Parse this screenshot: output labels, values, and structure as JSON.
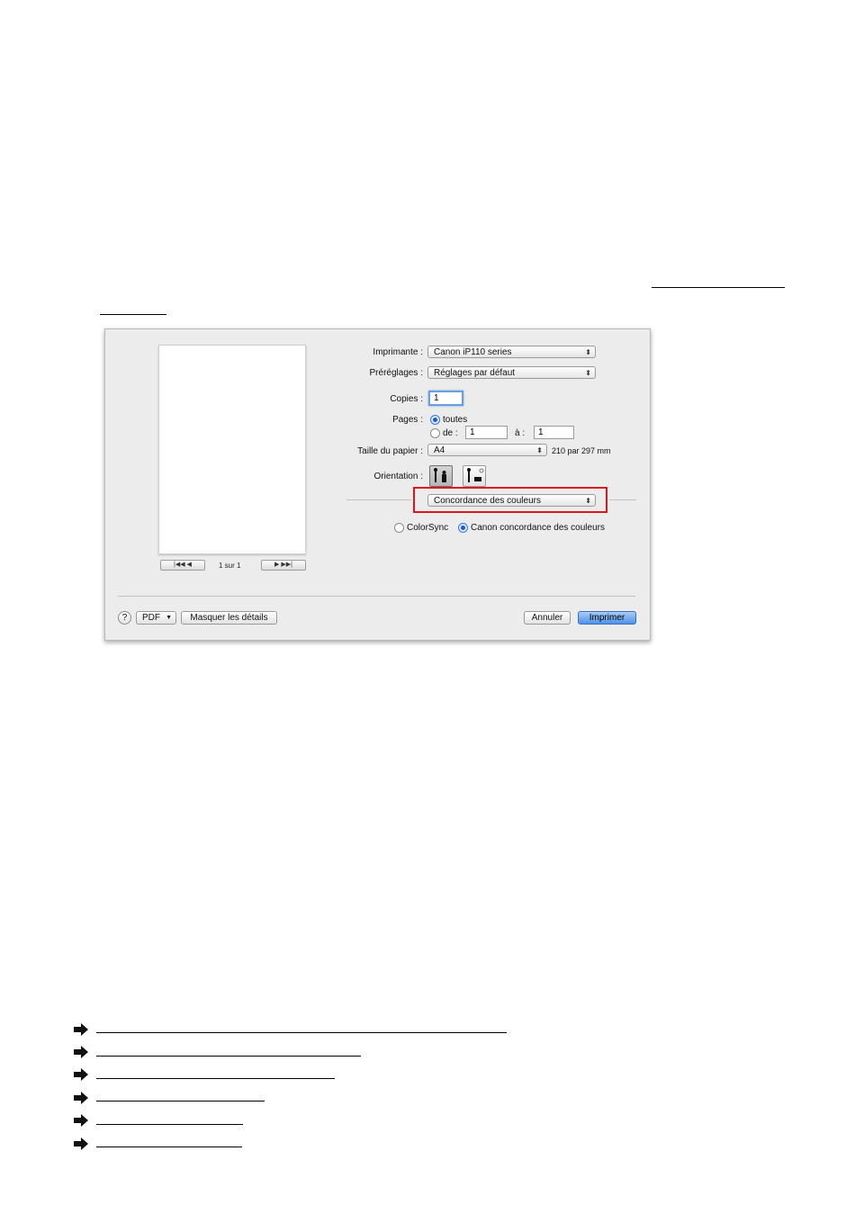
{
  "dialog": {
    "pager": {
      "first_prev": "|◀◀  ◀",
      "next_last": "▶  ▶▶|",
      "label": "1 sur 1"
    },
    "printer": {
      "label": "Imprimante :",
      "value": "Canon iP110 series"
    },
    "presets": {
      "label": "Préréglages :",
      "value": "Réglages par défaut"
    },
    "copies": {
      "label": "Copies :",
      "value": "1"
    },
    "pages": {
      "label": "Pages :",
      "all_label": "toutes",
      "from_label": "de :",
      "from_value": "1",
      "to_label": "à :",
      "to_value": "1",
      "selected": "all"
    },
    "paper_size": {
      "label": "Taille du papier :",
      "value": "A4",
      "dimensions": "210 par 297 mm"
    },
    "orientation": {
      "label": "Orientation :",
      "selected": "portrait"
    },
    "panel_menu": {
      "value": "Concordance des couleurs",
      "highlight_color": "#e0141c"
    },
    "color_matching": {
      "option1": "ColorSync",
      "option2": "Canon concordance des couleurs",
      "selected": "option2"
    },
    "footer": {
      "help": "?",
      "pdf": "PDF",
      "hide_details": "Masquer les détails",
      "cancel": "Annuler",
      "print": "Imprimer"
    },
    "accent_color": "#4d92ea"
  },
  "related_links_icon": "arrow-right-icon"
}
